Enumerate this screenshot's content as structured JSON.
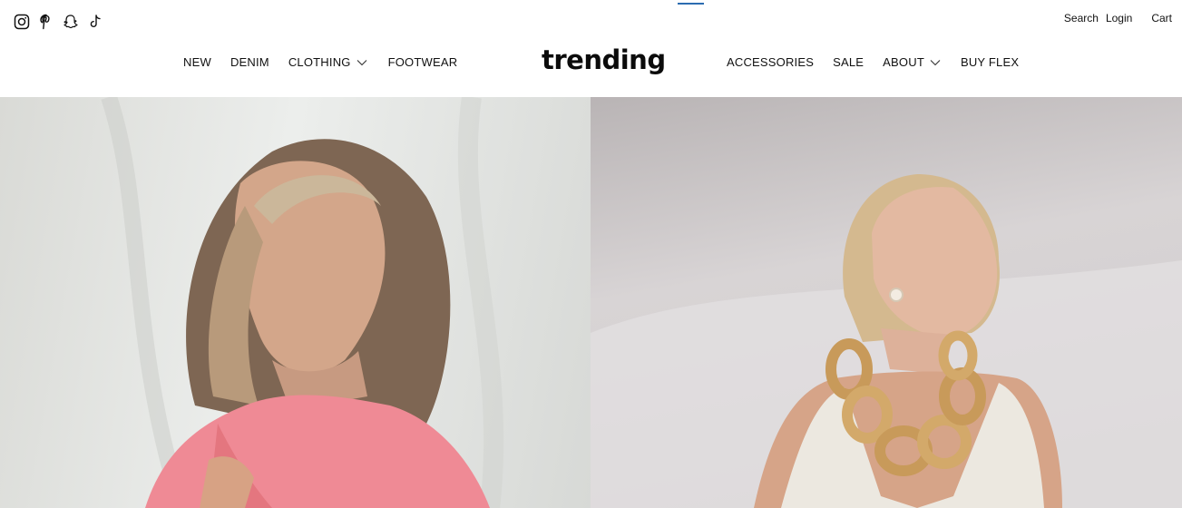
{
  "header": {
    "logo": "trending",
    "social_icons": [
      "instagram-icon",
      "pinterest-icon",
      "snapchat-icon",
      "tiktok-icon"
    ],
    "utility": {
      "search": "Search",
      "login": "Login",
      "cart": "Cart"
    },
    "nav_left": [
      {
        "label": "NEW",
        "dropdown": false
      },
      {
        "label": "DENIM",
        "dropdown": false
      },
      {
        "label": "CLOTHING",
        "dropdown": true
      },
      {
        "label": "FOOTWEAR",
        "dropdown": false
      }
    ],
    "nav_right": [
      {
        "label": "ACCESSORIES",
        "dropdown": false
      },
      {
        "label": "SALE",
        "dropdown": false
      },
      {
        "label": "ABOUT",
        "dropdown": true
      },
      {
        "label": "BUY FLEX",
        "dropdown": false
      }
    ]
  },
  "hero": {
    "panels": [
      "woman-pink-shirt-photo",
      "woman-gold-chain-necklace-photo"
    ]
  },
  "colors": {
    "accent": "#2b6cb0",
    "text": "#111111",
    "background": "#ffffff"
  }
}
